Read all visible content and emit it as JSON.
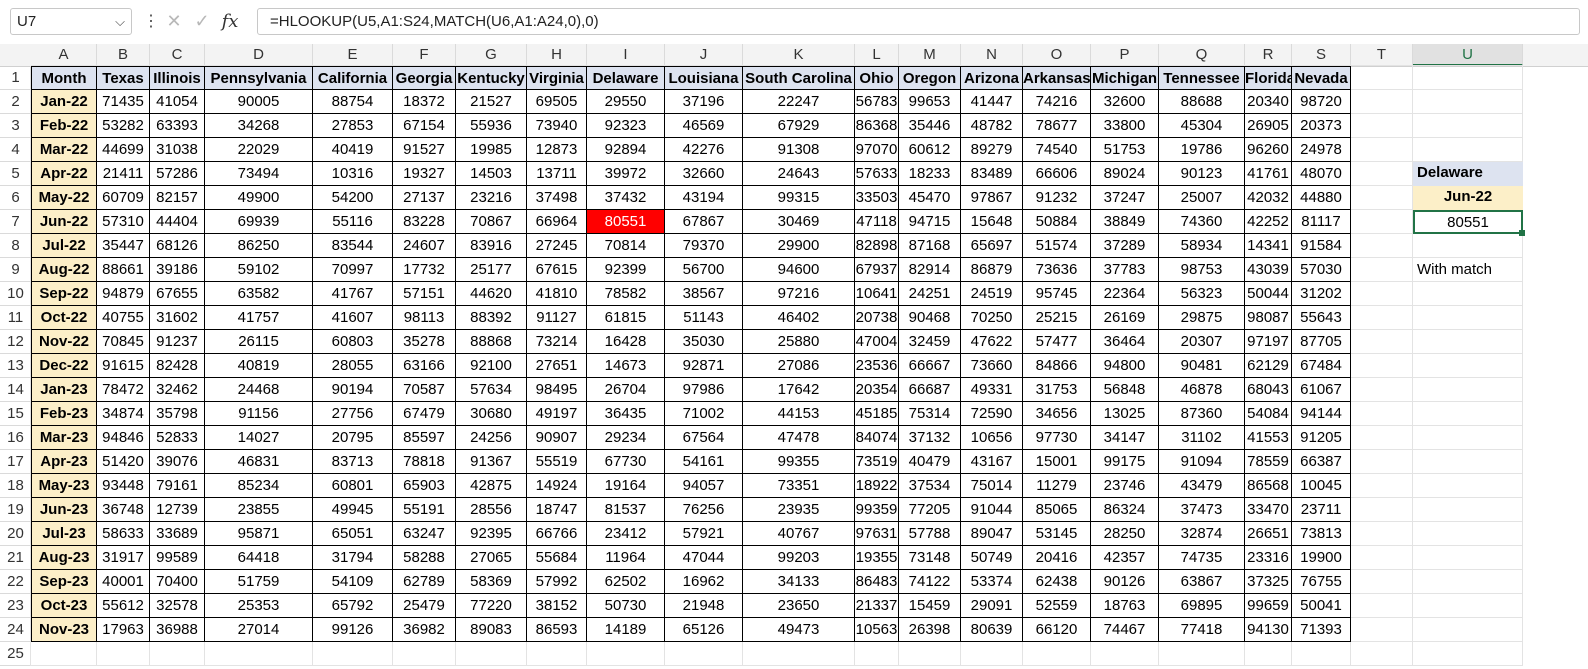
{
  "formula_bar": {
    "name_box": "U7",
    "formula": "=HLOOKUP(U5,A1:S24,MATCH(U6,A1:A24,0),0)",
    "icons": [
      "chevron-down-icon",
      "more-options-icon",
      "cancel-icon",
      "enter-icon",
      "fx-icon"
    ]
  },
  "columns": [
    "A",
    "B",
    "C",
    "D",
    "E",
    "F",
    "G",
    "H",
    "I",
    "J",
    "K",
    "L",
    "M",
    "N",
    "O",
    "P",
    "Q",
    "R",
    "S",
    "T",
    "U"
  ],
  "selected_column": "U",
  "row_numbers": [
    "1",
    "2",
    "3",
    "4",
    "5",
    "6",
    "7",
    "8",
    "9",
    "10",
    "11",
    "12",
    "13",
    "14",
    "15",
    "16",
    "17",
    "18",
    "19",
    "20",
    "21",
    "22",
    "23",
    "24",
    "25"
  ],
  "table": {
    "headers": [
      "Month",
      "Texas",
      "Illinois",
      "Pennsylvania",
      "California",
      "Georgia",
      "Kentucky",
      "Virginia",
      "Delaware",
      "Louisiana",
      "South Carolina",
      "Ohio",
      "Oregon",
      "Arizona",
      "Arkansas",
      "Michigan",
      "Tennessee",
      "Florida",
      "Nevada"
    ],
    "rows": [
      [
        "Jan-22",
        "71435",
        "41054",
        "90005",
        "88754",
        "18372",
        "21527",
        "69505",
        "29550",
        "37196",
        "22247",
        "56783",
        "99653",
        "41447",
        "74216",
        "32600",
        "88688",
        "20340",
        "98720"
      ],
      [
        "Feb-22",
        "53282",
        "63393",
        "34268",
        "27853",
        "67154",
        "55936",
        "73940",
        "92323",
        "46569",
        "67929",
        "86368",
        "35446",
        "48782",
        "78677",
        "33800",
        "45304",
        "26905",
        "20373"
      ],
      [
        "Mar-22",
        "44699",
        "31038",
        "22029",
        "40419",
        "91527",
        "19985",
        "12873",
        "92894",
        "42276",
        "91308",
        "97070",
        "60612",
        "89279",
        "74540",
        "51753",
        "19786",
        "96260",
        "24978"
      ],
      [
        "Apr-22",
        "21411",
        "57286",
        "73494",
        "10316",
        "19327",
        "14503",
        "13711",
        "39972",
        "32660",
        "24643",
        "57633",
        "18233",
        "83489",
        "66606",
        "89024",
        "90123",
        "41761",
        "48070"
      ],
      [
        "May-22",
        "60709",
        "82157",
        "49900",
        "54200",
        "27137",
        "23216",
        "37498",
        "37432",
        "43194",
        "99315",
        "33503",
        "45470",
        "97867",
        "91232",
        "37247",
        "25007",
        "42032",
        "44880"
      ],
      [
        "Jun-22",
        "57310",
        "44404",
        "69939",
        "55116",
        "83228",
        "70867",
        "66964",
        "80551",
        "67867",
        "30469",
        "47118",
        "94715",
        "15648",
        "50884",
        "38849",
        "74360",
        "42252",
        "81117"
      ],
      [
        "Jul-22",
        "35447",
        "68126",
        "86250",
        "83544",
        "24607",
        "83916",
        "27245",
        "70814",
        "79370",
        "29900",
        "82898",
        "87168",
        "65697",
        "51574",
        "37289",
        "58934",
        "14341",
        "91584"
      ],
      [
        "Aug-22",
        "88661",
        "39186",
        "59102",
        "70997",
        "17732",
        "25177",
        "67615",
        "92399",
        "56700",
        "94600",
        "67937",
        "82914",
        "86879",
        "73636",
        "37783",
        "98753",
        "43039",
        "57030"
      ],
      [
        "Sep-22",
        "94879",
        "67655",
        "63582",
        "41767",
        "57151",
        "44620",
        "41810",
        "78582",
        "38567",
        "97216",
        "10641",
        "24251",
        "24519",
        "95745",
        "22364",
        "56323",
        "50044",
        "31202"
      ],
      [
        "Oct-22",
        "40755",
        "31602",
        "41757",
        "41607",
        "98113",
        "88392",
        "91127",
        "61815",
        "51143",
        "46402",
        "20738",
        "90468",
        "70250",
        "25215",
        "26169",
        "29875",
        "98087",
        "55643"
      ],
      [
        "Nov-22",
        "70845",
        "91237",
        "26115",
        "60803",
        "35278",
        "88868",
        "73214",
        "16428",
        "35030",
        "25880",
        "47004",
        "32459",
        "47622",
        "57477",
        "36464",
        "20307",
        "97197",
        "87705"
      ],
      [
        "Dec-22",
        "91615",
        "82428",
        "40819",
        "28055",
        "63166",
        "92100",
        "27651",
        "14673",
        "92871",
        "27086",
        "23536",
        "66667",
        "73660",
        "84866",
        "94800",
        "90481",
        "62129",
        "67484"
      ],
      [
        "Jan-23",
        "78472",
        "32462",
        "24468",
        "90194",
        "70587",
        "57634",
        "98495",
        "26704",
        "97986",
        "17642",
        "20354",
        "66687",
        "49331",
        "31753",
        "56848",
        "46878",
        "68043",
        "61067"
      ],
      [
        "Feb-23",
        "34874",
        "35798",
        "91156",
        "27756",
        "67479",
        "30680",
        "49197",
        "36435",
        "71002",
        "44153",
        "45185",
        "75314",
        "72590",
        "34656",
        "13025",
        "87360",
        "54084",
        "94144"
      ],
      [
        "Mar-23",
        "94846",
        "52833",
        "14027",
        "20795",
        "85597",
        "24256",
        "90907",
        "29234",
        "67564",
        "47478",
        "84074",
        "37132",
        "10656",
        "97730",
        "34147",
        "31102",
        "41553",
        "91205"
      ],
      [
        "Apr-23",
        "51420",
        "39076",
        "46831",
        "83713",
        "78818",
        "91367",
        "55519",
        "67730",
        "54161",
        "99355",
        "73519",
        "40479",
        "43167",
        "15001",
        "99175",
        "91094",
        "78559",
        "66387"
      ],
      [
        "May-23",
        "93448",
        "79161",
        "85234",
        "60801",
        "65903",
        "42875",
        "14924",
        "19164",
        "94057",
        "73351",
        "18922",
        "37534",
        "75014",
        "11279",
        "23746",
        "43479",
        "86568",
        "10045"
      ],
      [
        "Jun-23",
        "36748",
        "12739",
        "23855",
        "49945",
        "55191",
        "28556",
        "18747",
        "81537",
        "76256",
        "23935",
        "99359",
        "77205",
        "91044",
        "85065",
        "86324",
        "37473",
        "33470",
        "23711"
      ],
      [
        "Jul-23",
        "58633",
        "33689",
        "95871",
        "65051",
        "63247",
        "92395",
        "66766",
        "23412",
        "57921",
        "40767",
        "97631",
        "57788",
        "89047",
        "53145",
        "28250",
        "32874",
        "26651",
        "73813"
      ],
      [
        "Aug-23",
        "31917",
        "99589",
        "64418",
        "31794",
        "58288",
        "27065",
        "55684",
        "11964",
        "47044",
        "99203",
        "19355",
        "73148",
        "50749",
        "20416",
        "42357",
        "74735",
        "23316",
        "19900"
      ],
      [
        "Sep-23",
        "40001",
        "70400",
        "51759",
        "54109",
        "62789",
        "58369",
        "57992",
        "62502",
        "16962",
        "34133",
        "86483",
        "74122",
        "53374",
        "62438",
        "90126",
        "63867",
        "37325",
        "76755"
      ],
      [
        "Oct-23",
        "55612",
        "32578",
        "25353",
        "65792",
        "25479",
        "77220",
        "38152",
        "50730",
        "21948",
        "23650",
        "21337",
        "15459",
        "29091",
        "52559",
        "18763",
        "69895",
        "99659",
        "50041"
      ],
      [
        "Nov-23",
        "17963",
        "36988",
        "27014",
        "99126",
        "36982",
        "89083",
        "86593",
        "14189",
        "65126",
        "49473",
        "10563",
        "26398",
        "80639",
        "66120",
        "74467",
        "77418",
        "94130",
        "71393"
      ]
    ],
    "highlight": {
      "row": 5,
      "col": 8,
      "color": "#ff0000"
    }
  },
  "lookup": {
    "state": "Delaware",
    "month": "Jun-22",
    "result": "80551",
    "note": "With match"
  }
}
